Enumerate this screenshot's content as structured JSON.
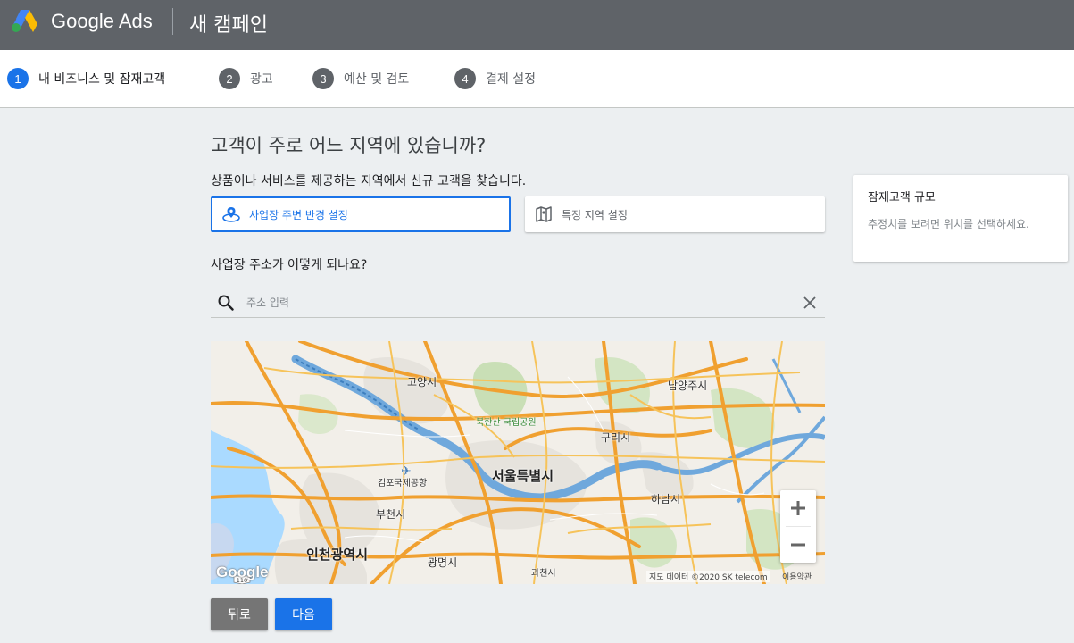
{
  "app": {
    "brand": "Google Ads",
    "campaign_title": "새 캠페인"
  },
  "steps": [
    {
      "num": "1",
      "label": "내 비즈니스 및 잠재고객",
      "active": true
    },
    {
      "num": "2",
      "label": "광고",
      "active": false
    },
    {
      "num": "3",
      "label": "예산 및 검토",
      "active": false
    },
    {
      "num": "4",
      "label": "결제 설정",
      "active": false
    }
  ],
  "main": {
    "question": "고객이 주로 어느 지역에 있습니까?",
    "subtitle": "상품이나 서비스를 제공하는 지역에서 신규 고객을 찾습니다.",
    "options": [
      {
        "label": "사업장 주변 반경 설정",
        "icon": "location-radius-icon",
        "selected": true
      },
      {
        "label": "특정 지역 설정",
        "icon": "map-icon",
        "selected": false
      }
    ],
    "address_question": "사업장 주소가 어떻게 되나요?",
    "search": {
      "placeholder": "주소 입력",
      "value": ""
    }
  },
  "map": {
    "labels": {
      "goyang": "고양시",
      "namyangju": "남양주시",
      "bukhansan": "북한산 국립공원",
      "guri": "구리시",
      "seoul": "서울특별시",
      "gimpo_airport": "김포국제공항",
      "hanam": "하남시",
      "bucheon": "부천시",
      "incheon": "인천광역시",
      "gwangmyeong": "광명시",
      "gwacheon": "과천시"
    },
    "logo": "Google",
    "attribution": "지도 데이터 ©2020 SK telecom",
    "terms": "이용약관",
    "route_shield": "110"
  },
  "buttons": {
    "back": "뒤로",
    "next": "다음"
  },
  "side_card": {
    "title": "잠재고객 규모",
    "description": "추정치를 보려면 위치를 선택하세요."
  },
  "colors": {
    "accent": "#1a73e8",
    "topbar": "#5f6368",
    "background": "#eceff1"
  }
}
